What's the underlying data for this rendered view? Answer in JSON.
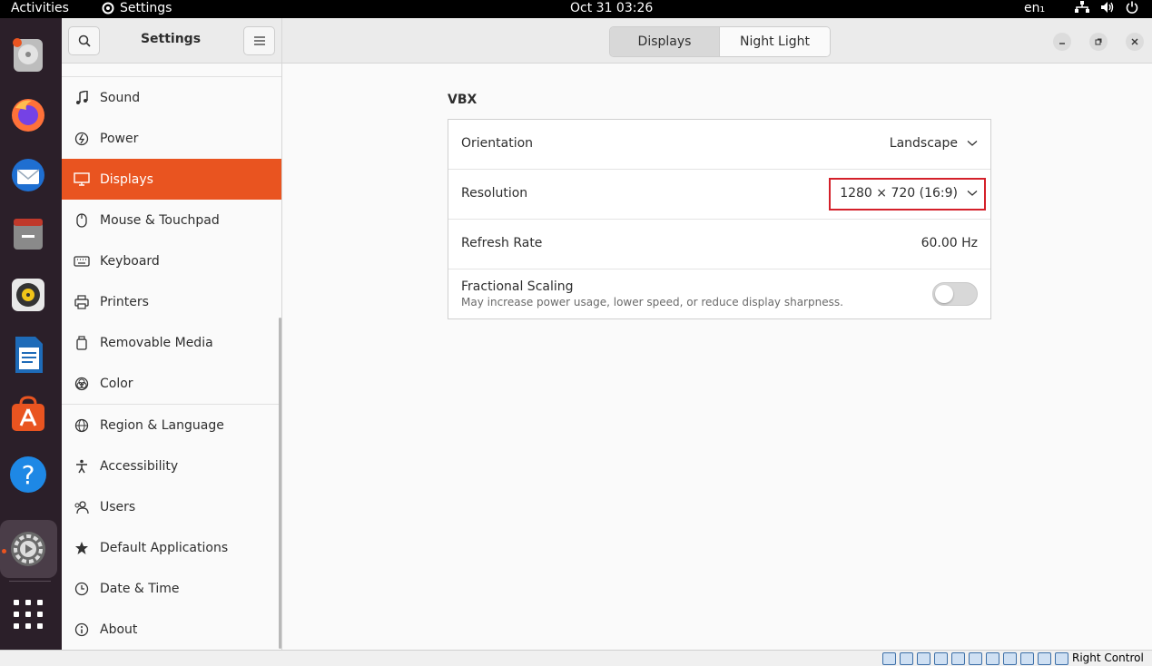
{
  "topbar": {
    "activities": "Activities",
    "app_name": "Settings",
    "clock": "Oct 31  03:26",
    "language": "en₁"
  },
  "dock": {
    "items": [
      {
        "name": "Disks",
        "icon": "disk-icon"
      },
      {
        "name": "Firefox",
        "icon": "firefox-icon"
      },
      {
        "name": "Thunderbird",
        "icon": "thunderbird-icon"
      },
      {
        "name": "Files",
        "icon": "files-icon"
      },
      {
        "name": "Rhythmbox",
        "icon": "rhythmbox-icon"
      },
      {
        "name": "LibreOffice Writer",
        "icon": "writer-icon"
      },
      {
        "name": "Ubuntu Software",
        "icon": "software-icon"
      },
      {
        "name": "Help",
        "icon": "help-icon"
      },
      {
        "name": "Settings",
        "icon": "settings-icon"
      },
      {
        "name": "Show Applications",
        "icon": "app-grid-icon"
      }
    ]
  },
  "sidebar": {
    "title": "Settings",
    "items": [
      {
        "label": "Sound",
        "icon": "music-note-icon"
      },
      {
        "label": "Power",
        "icon": "power-icon"
      },
      {
        "label": "Displays",
        "icon": "display-icon"
      },
      {
        "label": "Mouse & Touchpad",
        "icon": "mouse-icon"
      },
      {
        "label": "Keyboard",
        "icon": "keyboard-icon"
      },
      {
        "label": "Printers",
        "icon": "printer-icon"
      },
      {
        "label": "Removable Media",
        "icon": "media-icon"
      },
      {
        "label": "Color",
        "icon": "color-icon"
      },
      {
        "label": "Region & Language",
        "icon": "globe-icon"
      },
      {
        "label": "Accessibility",
        "icon": "accessibility-icon"
      },
      {
        "label": "Users",
        "icon": "users-icon"
      },
      {
        "label": "Default Applications",
        "icon": "star-icon"
      },
      {
        "label": "Date & Time",
        "icon": "clock-icon"
      },
      {
        "label": "About",
        "icon": "info-icon"
      }
    ],
    "active_index": 2
  },
  "header": {
    "tabs": [
      {
        "label": "Displays",
        "active": true
      },
      {
        "label": "Night Light",
        "active": false
      }
    ]
  },
  "main": {
    "display_name": "VBX",
    "orientation": {
      "label": "Orientation",
      "value": "Landscape"
    },
    "resolution": {
      "label": "Resolution",
      "value": "1280 × 720 (16:9)"
    },
    "refresh_rate": {
      "label": "Refresh Rate",
      "value": "60.00 Hz"
    },
    "fractional_scaling": {
      "label": "Fractional Scaling",
      "description": "May increase power usage, lower speed, or reduce display sharpness.",
      "enabled": false
    }
  },
  "statusbar": {
    "host_key": "Right Control"
  },
  "colors": {
    "accent": "#e95420",
    "highlight_box": "#d4202a",
    "dock_bg": "#2b1f29"
  }
}
